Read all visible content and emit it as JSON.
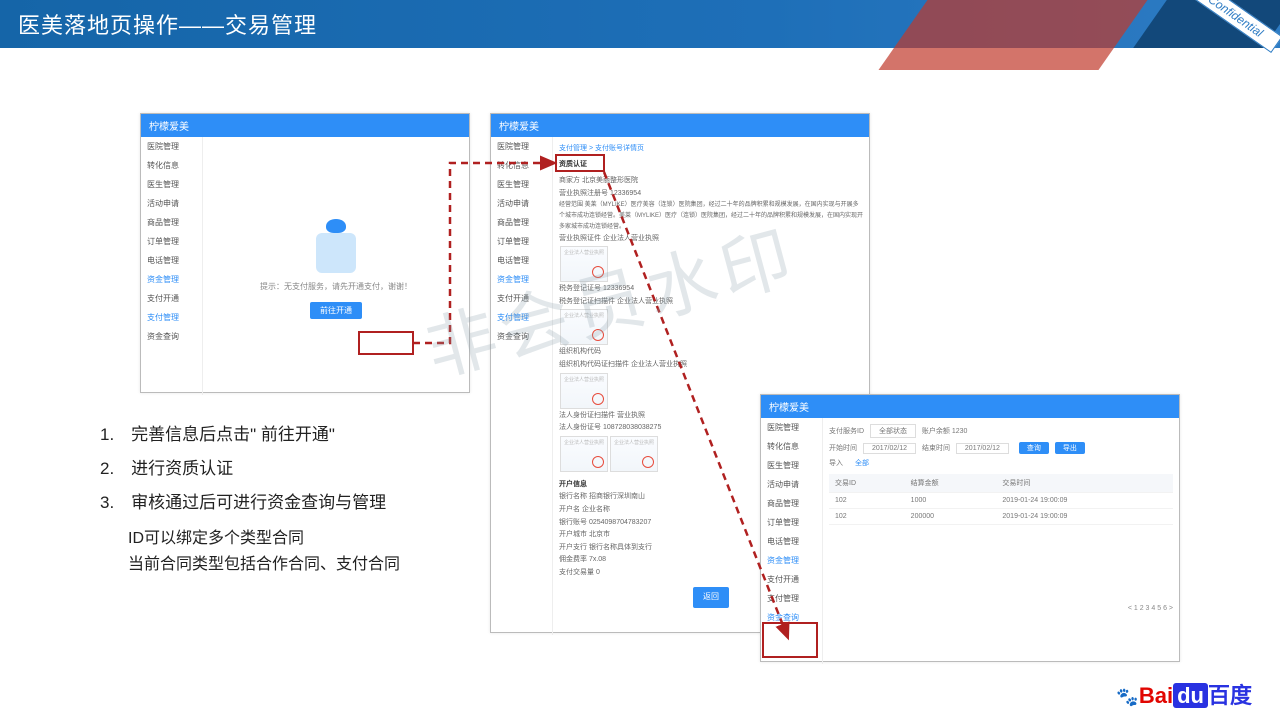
{
  "header": {
    "title": "医美落地页操作——交易管理"
  },
  "confidential": "Confidential",
  "watermark": "非会员水印",
  "app_name": "柠檬爱美",
  "sidebar": {
    "items": [
      "医院管理",
      "转化信息",
      "医生管理",
      "活动申请",
      "商品管理",
      "订单管理",
      "电话管理",
      "资金管理"
    ],
    "sub": [
      "支付开通",
      "支付管理",
      "资金查询"
    ]
  },
  "shot1": {
    "tip": "提示：无支付服务，请先开通支付，谢谢！",
    "btn": "前往开通"
  },
  "shot2": {
    "breadcrumb": "支付管理 > 支付账号详情页",
    "section1": "资质认证",
    "fields": {
      "merchant": "商家方   北京美丽整形医院",
      "lic_no": "营业执照注册号   12336954",
      "scope": "经营范围   美莱（MYLIKE）医疗美容（连锁）医院集团，经过二十年的品牌积累和规模发展，在国内实现与开展多个城市成功连锁经营。美莱（MYLIKE）医疗（连锁）医院集团，经过二十年的品牌积累和规模发展，在国内实现开多家城市成功连锁经营。",
      "lic_file": "营业执照证件   企业法人营业执照",
      "tax_no": "税务登记证号   12336954",
      "tax_file": "税务登记证扫描件   企业法人营业执照",
      "org_no": "组织机构代码",
      "org_file": "组织机构代码证扫描件   企业法人营业执照",
      "id_file": "法人身份证扫描件   营业执照",
      "id_no": "法人身份证号   108728038038275",
      "biz_lic": "企业法人营业执照   企业法人营业执照",
      "bank_section": "开户信息",
      "bank_name": "银行名称   招商银行深圳南山",
      "acct_name": "开户名   企业名称",
      "acct_no": "银行账号   0254098704783207",
      "city": "开户城市   北京市",
      "branch": "开户支行   银行名称具体到支行",
      "rate": "佣金费率   7x.08",
      "count": "支付交易量   0"
    },
    "back_btn": "返回"
  },
  "shot3": {
    "filter": {
      "status_lbl": "支付服务ID",
      "status_val": "全部状态",
      "acct_lbl": "账户余额",
      "acct_val": "1230",
      "start_lbl": "开始时间",
      "start_val": "2017/02/12",
      "end_lbl": "结束时间",
      "end_val": "2017/02/12",
      "btn1": "查询",
      "btn2": "导出"
    },
    "import_lbl": "导入",
    "import_link": "全部",
    "cols": [
      "交易ID",
      "结算金额",
      "交易时间"
    ],
    "rows": [
      [
        "102",
        "1000",
        "2019-01-24 19:00:09"
      ],
      [
        "102",
        "200000",
        "2019-01-24 19:00:09"
      ]
    ],
    "pager": "< 1 2 3 4 5 6 >"
  },
  "steps": {
    "s1": "1.　完善信息后点击\" 前往开通\"",
    "s2": "2.　进行资质认证",
    "s3": "3.　审核通过后可进行资金查询与管理",
    "n1": "ID可以绑定多个类型合同",
    "n2": "当前合同类型包括合作合同、支付合同"
  },
  "logo": {
    "bai": "Bai",
    "du": "du",
    "cn": "百度"
  }
}
